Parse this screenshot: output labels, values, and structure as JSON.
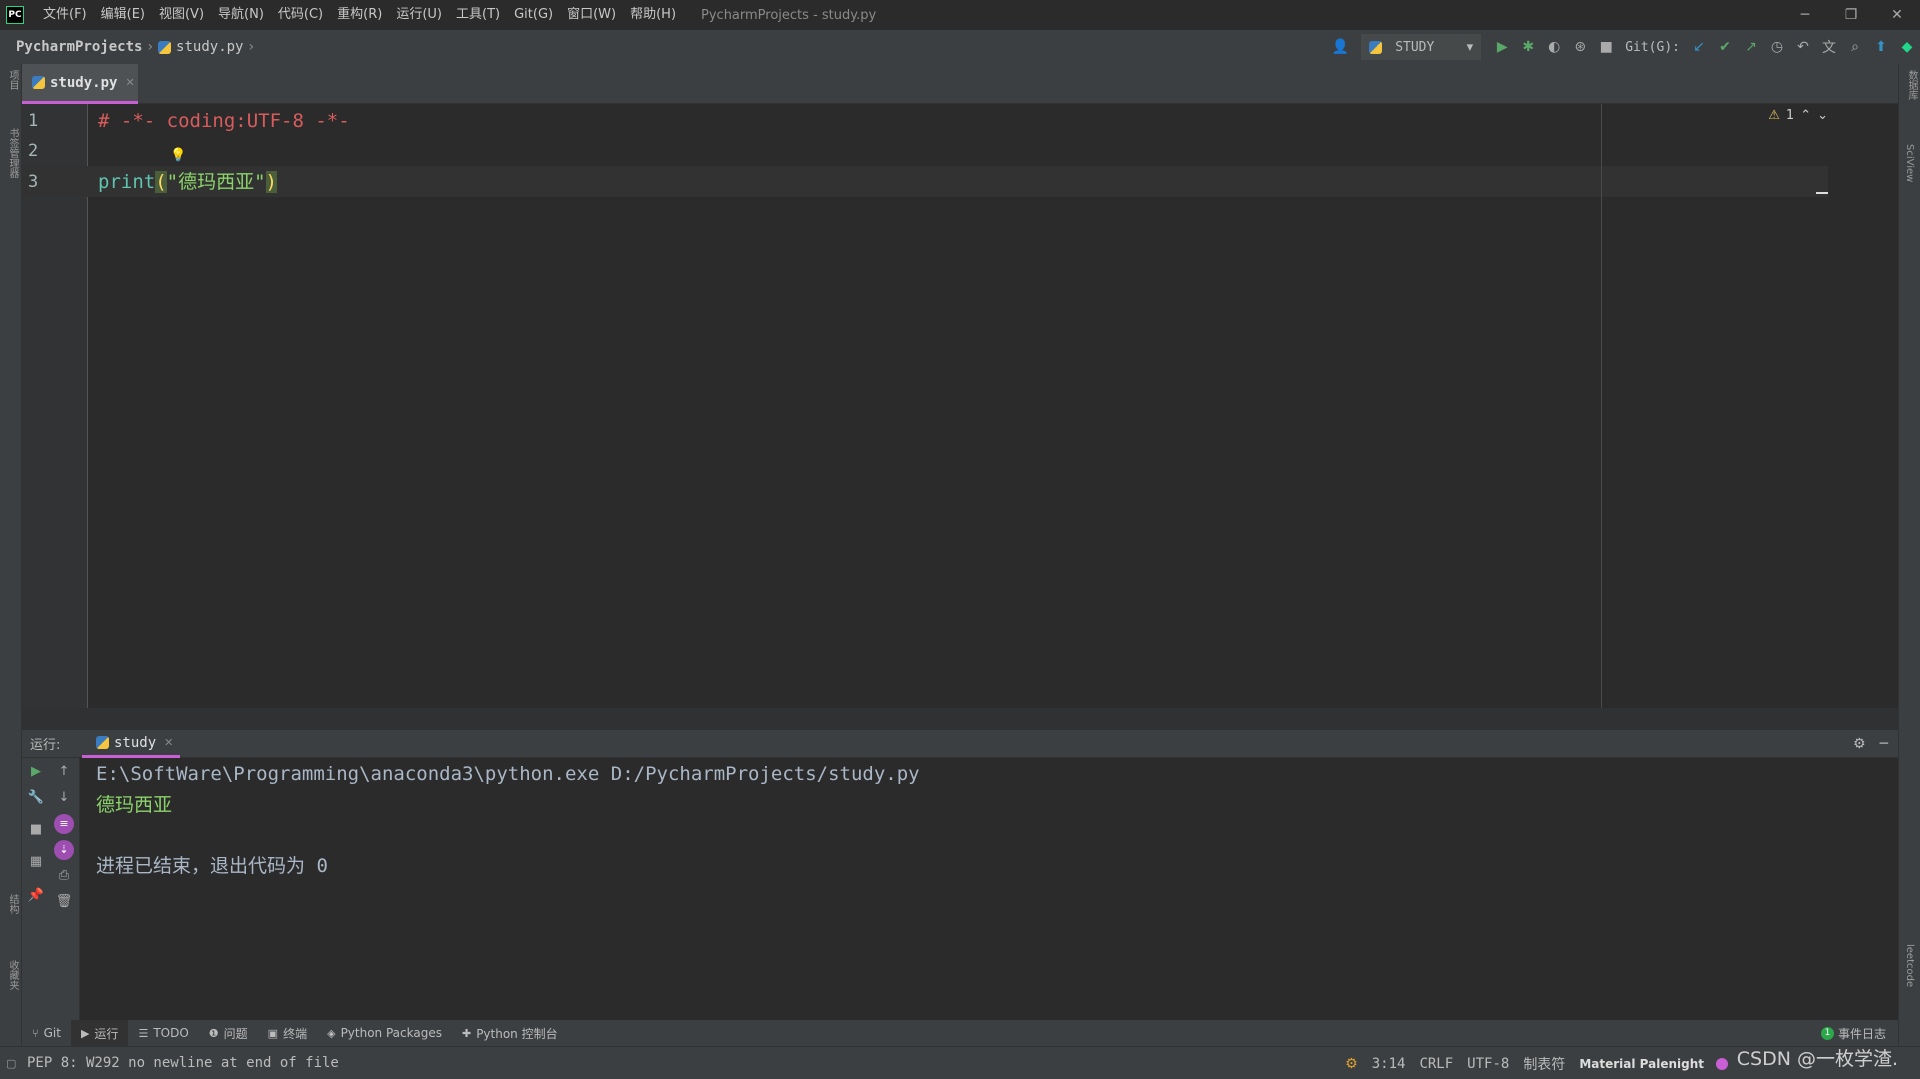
{
  "titlebar": {
    "logo": "PC",
    "menu": [
      "文件(F)",
      "编辑(E)",
      "视图(V)",
      "导航(N)",
      "代码(C)",
      "重构(R)",
      "运行(U)",
      "工具(T)",
      "Git(G)",
      "窗口(W)",
      "帮助(H)"
    ],
    "window_title": "PycharmProjects - study.py",
    "controls": {
      "minimize": "─",
      "restore": "❐",
      "close": "✕"
    }
  },
  "navbar": {
    "project": "PycharmProjects",
    "file": "study.py",
    "sep": "›",
    "run_config": "STUDY",
    "git_label": "Git(G):"
  },
  "left_strip": {
    "labels": [
      "项目",
      "书签管理器",
      "结构",
      "收藏夹"
    ]
  },
  "right_strip": {
    "labels": [
      "数据库",
      "SciView",
      "leetcode"
    ]
  },
  "editor": {
    "tab_label": "study.py",
    "line_numbers": [
      "1",
      "2",
      "3"
    ],
    "line1": "# -*- coding:UTF-8 -*-",
    "line3": {
      "func": "print",
      "open": "(",
      "string": "\"德玛西亚\"",
      "close": ")"
    },
    "inspection_count": "1"
  },
  "run_panel": {
    "label": "运行:",
    "tab": "study",
    "console": {
      "command": "E:\\SoftWare\\Programming\\anaconda3\\python.exe D:/PycharmProjects/study.py",
      "output": "德玛西亚",
      "exit": "进程已结束，退出代码为 0"
    }
  },
  "tool_windows": [
    {
      "icon": "git-branch-icon",
      "glyph": "⑂",
      "label": "Git"
    },
    {
      "icon": "run-icon",
      "glyph": "▶",
      "label": "运行"
    },
    {
      "icon": "todo-icon",
      "glyph": "☰",
      "label": "TODO"
    },
    {
      "icon": "problems-icon",
      "glyph": "❶",
      "label": "问题"
    },
    {
      "icon": "terminal-icon",
      "glyph": "▣",
      "label": "终端"
    },
    {
      "icon": "packages-icon",
      "glyph": "◈",
      "label": "Python Packages"
    },
    {
      "icon": "python-console-icon",
      "glyph": "✚",
      "label": "Python 控制台"
    }
  ],
  "event_log": {
    "count": "1",
    "label": "事件日志"
  },
  "statusbar": {
    "message": "PEP 8: W292 no newline at end of file",
    "position": "3:14",
    "line_sep": "CRLF",
    "encoding": "UTF-8",
    "indent": "制表符",
    "theme": "Material Palenight",
    "watermark": "CSDN @一枚学渣."
  },
  "colors": {
    "accent": "#c95fd5",
    "comment": "#d95c5c",
    "string": "#8bd36a",
    "function": "#5fc4b0"
  }
}
